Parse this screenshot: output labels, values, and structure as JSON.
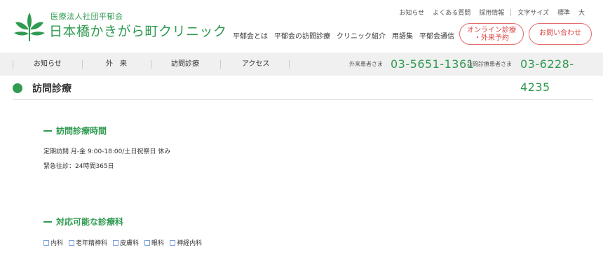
{
  "header": {
    "corp_name": "医療法人社団平郁会",
    "clinic_name": "日本橋かきがら町クリニック",
    "utility": [
      "お知らせ",
      "よくある質問",
      "採用情報",
      "文字サイズ",
      "標準",
      "大"
    ],
    "nav": [
      "平郁会とは",
      "平郁会の訪問診療",
      "クリニック紹介",
      "用語集",
      "平郁会通信"
    ],
    "online_button": [
      "オンライン診療",
      "・外来予約"
    ],
    "contact_button": "お問い合わせ"
  },
  "subnav": {
    "items": [
      "お知らせ",
      "外　来",
      "訪問診療",
      "アクセス"
    ],
    "outpatient_label": "外来患者さま",
    "outpatient_tel": "03-5651-1361",
    "home_visit_label": "訪問診療患者さま",
    "home_visit_tel": "03-6228-4235"
  },
  "page": {
    "title": "訪問診療"
  },
  "hours": {
    "heading": "訪問診療時間",
    "line1": "定期訪問 月-金 9:00-18:00/土日祝祭日 休み",
    "line2": "緊急往診：24時間365日"
  },
  "departments": {
    "heading": "対応可能な診療科",
    "items": [
      "内科",
      "老年精神科",
      "皮膚科",
      "眼科",
      "神経内科"
    ]
  },
  "colors": {
    "brand_green": "#2f9a50",
    "button_red": "#e36a6a",
    "subnav_bg": "#f0f0f0"
  }
}
